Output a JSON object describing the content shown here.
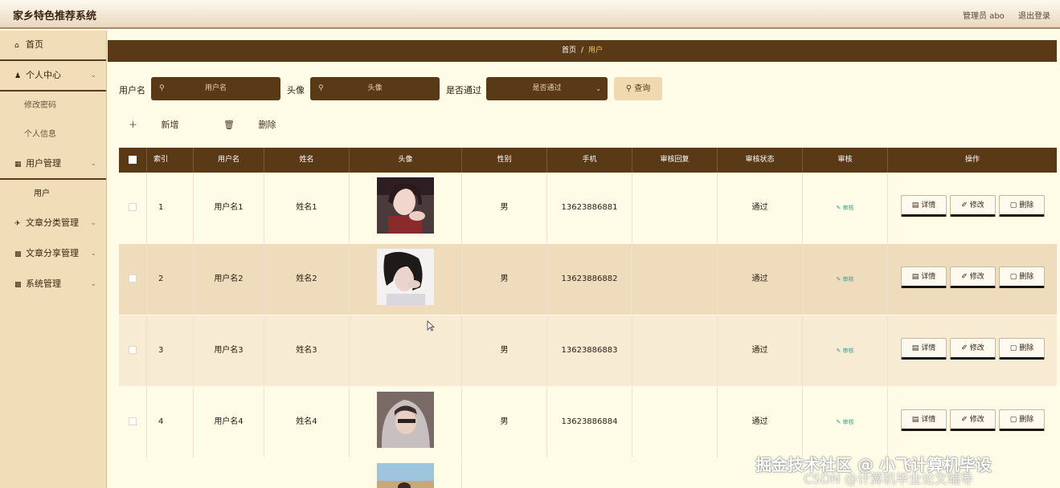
{
  "app": {
    "title": "家乡特色推荐系统"
  },
  "header": {
    "user": "管理员 abo",
    "logout": "退出登录"
  },
  "sidebar": {
    "items": [
      {
        "icon": "home-icon",
        "label": "首页"
      },
      {
        "icon": "person-icon",
        "label": "个人中心"
      },
      {
        "sub": "修改密码"
      },
      {
        "sub": "个人信息"
      },
      {
        "icon": "table-icon",
        "label": "用户管理"
      },
      {
        "sub": "用户"
      },
      {
        "icon": "send-icon",
        "label": "文章分类管理"
      },
      {
        "icon": "grid-icon",
        "label": "文章分享管理"
      },
      {
        "icon": "grid-icon",
        "label": "系统管理"
      }
    ]
  },
  "breadcrumb": {
    "home": "首页",
    "sep": "/",
    "current": "用户"
  },
  "search": {
    "username_label": "用户名",
    "username_placeholder": "用户名",
    "avatar_label": "头像",
    "avatar_placeholder": "头像",
    "passed_label": "是否通过",
    "passed_placeholder": "是否通过",
    "query_button": "查询"
  },
  "actions": {
    "add": "新增",
    "delete": "删除"
  },
  "table": {
    "columns": [
      "索引",
      "用户名",
      "姓名",
      "头像",
      "性别",
      "手机",
      "审核回复",
      "审核状态",
      "审核",
      "操作"
    ],
    "rows": [
      {
        "index": "1",
        "username": "用户名1",
        "name": "姓名1",
        "gender": "男",
        "phone": "13623886881",
        "reply": "",
        "status": "通过",
        "audit": "审核"
      },
      {
        "index": "2",
        "username": "用户名2",
        "name": "姓名2",
        "gender": "男",
        "phone": "13623886882",
        "reply": "",
        "status": "通过",
        "audit": "审核"
      },
      {
        "index": "3",
        "username": "用户名3",
        "name": "姓名3",
        "gender": "男",
        "phone": "13623886883",
        "reply": "",
        "status": "通过",
        "audit": "审核"
      },
      {
        "index": "4",
        "username": "用户名4",
        "name": "姓名4",
        "gender": "男",
        "phone": "13623886884",
        "reply": "",
        "status": "通过",
        "audit": "审核"
      }
    ],
    "ops": {
      "detail": "详情",
      "edit": "修改",
      "delete": "删除"
    }
  },
  "watermark": {
    "line1": "掘金技术社区 @ 小飞计算机毕设",
    "line2": "CSDN @计算机毕业论文辅导"
  },
  "colors": {
    "brown": "#5a3a16",
    "sidebar": "#f1deb9",
    "page": "#fefbe6",
    "accent": "#f2c36b"
  }
}
